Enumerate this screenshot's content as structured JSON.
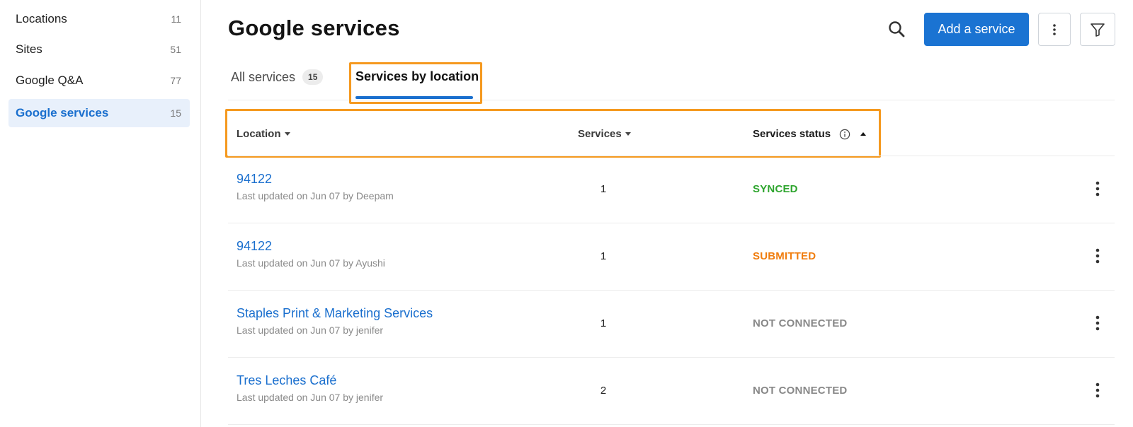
{
  "sidebar": {
    "items": [
      {
        "label": "Locations",
        "count": "11"
      },
      {
        "label": "Sites",
        "count": "51"
      },
      {
        "label": "Google Q&A",
        "count": "77"
      },
      {
        "label": "Google services",
        "count": "15",
        "active": true
      }
    ]
  },
  "header": {
    "title": "Google services",
    "search_icon": "search-icon",
    "add_label": "Add a service",
    "more_icon": "more-vertical-icon",
    "filter_icon": "filter-icon"
  },
  "tabs": [
    {
      "label": "All services",
      "count": "15"
    },
    {
      "label": "Services by location",
      "active": true
    }
  ],
  "table": {
    "columns": {
      "location": "Location",
      "services": "Services",
      "status": "Services status"
    },
    "sort": {
      "column": "status",
      "direction": "ascending"
    },
    "rows": [
      {
        "name": "94122",
        "updated": "Last updated on Jun 07 by Deepam",
        "services": "1",
        "status": "SYNCED",
        "status_color": "#2ea52e"
      },
      {
        "name": "94122",
        "updated": "Last updated on Jun 07 by Ayushi",
        "services": "1",
        "status": "SUBMITTED",
        "status_color": "#f07d0e"
      },
      {
        "name": "Staples Print & Marketing Services",
        "updated": "Last updated on Jun 07 by jenifer",
        "services": "1",
        "status": "NOT CONNECTED",
        "status_color": "#888888"
      },
      {
        "name": "Tres Leches Café",
        "updated": "Last updated on Jun 07 by jenifer",
        "services": "2",
        "status": "NOT CONNECTED",
        "status_color": "#888888"
      }
    ]
  },
  "colors": {
    "accent": "#1a73d2",
    "highlight": "#f5991f"
  }
}
